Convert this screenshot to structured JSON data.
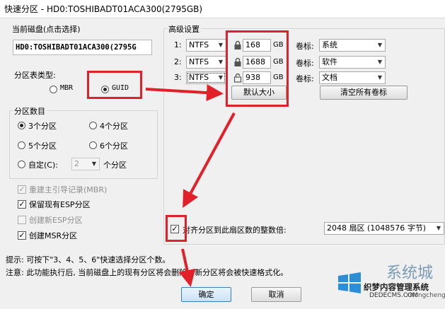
{
  "window": {
    "title": "快速分区 - HD0:TOSHIBADT01ACA300(2795GB)"
  },
  "disk": {
    "label": "当前磁盘(点击选择)",
    "value": "HD0:TOSHIBADT01ACA300(2795G"
  },
  "partition_table": {
    "label": "分区表类型:",
    "options": [
      "MBR",
      "GUID"
    ],
    "selected": "GUID"
  },
  "partition_count": {
    "label": "分区数目",
    "options": [
      "3个分区",
      "4个分区",
      "5个分区",
      "6个分区"
    ],
    "selected": "3个分区",
    "custom_label": "自定(C):",
    "custom_value": "2",
    "custom_unit": "个分区"
  },
  "checks": [
    {
      "label": "重建主引导记录(MBR)",
      "checked": true,
      "enabled": false
    },
    {
      "label": "保留现有ESP分区",
      "checked": true,
      "enabled": true
    },
    {
      "label": "创建新ESP分区",
      "checked": false,
      "enabled": false
    },
    {
      "label": "创建MSR分区",
      "checked": true,
      "enabled": true
    }
  ],
  "advanced": {
    "label": "高级设置",
    "rows": [
      {
        "index": "1:",
        "fs": "NTFS",
        "size": "168",
        "unit": "GB",
        "vol_label": "卷标:",
        "volume": "系统"
      },
      {
        "index": "2:",
        "fs": "NTFS",
        "size": "1688",
        "unit": "GB",
        "vol_label": "卷标:",
        "volume": "软件"
      },
      {
        "index": "3:",
        "fs": "NTFS",
        "size": "938",
        "unit": "GB",
        "vol_label": "卷标:",
        "volume": "文档"
      }
    ],
    "default_size_button": "默认大小",
    "clear_labels_button": "清空所有卷标"
  },
  "align": {
    "label": "对齐分区到此扇区数的整数倍:",
    "checked": true,
    "value": "2048 扇区 (1048576 字节)"
  },
  "hints": {
    "tip": "提示: 可按下\"3、4、5、6\"快速选择分区个数。",
    "note": "注意: 此功能执行后, 当前磁盘上的现有分区将会删除。新分区将会被快速格式化。"
  },
  "buttons": {
    "ok": "确定",
    "cancel": "取消"
  },
  "watermark": {
    "brand": "系统城",
    "line1": "织梦内容管理系统",
    "line2": "DEDECMS.COM",
    "line3": "xitongcheng.com"
  },
  "colors": {
    "highlight": "#e1202a",
    "window_bg": "#f0f0f0",
    "default_button": "#3c7fb1"
  },
  "icons": [
    "lock-icon",
    "unlock-icon",
    "dropdown-arrow-icon",
    "windows-logo-icon"
  ]
}
